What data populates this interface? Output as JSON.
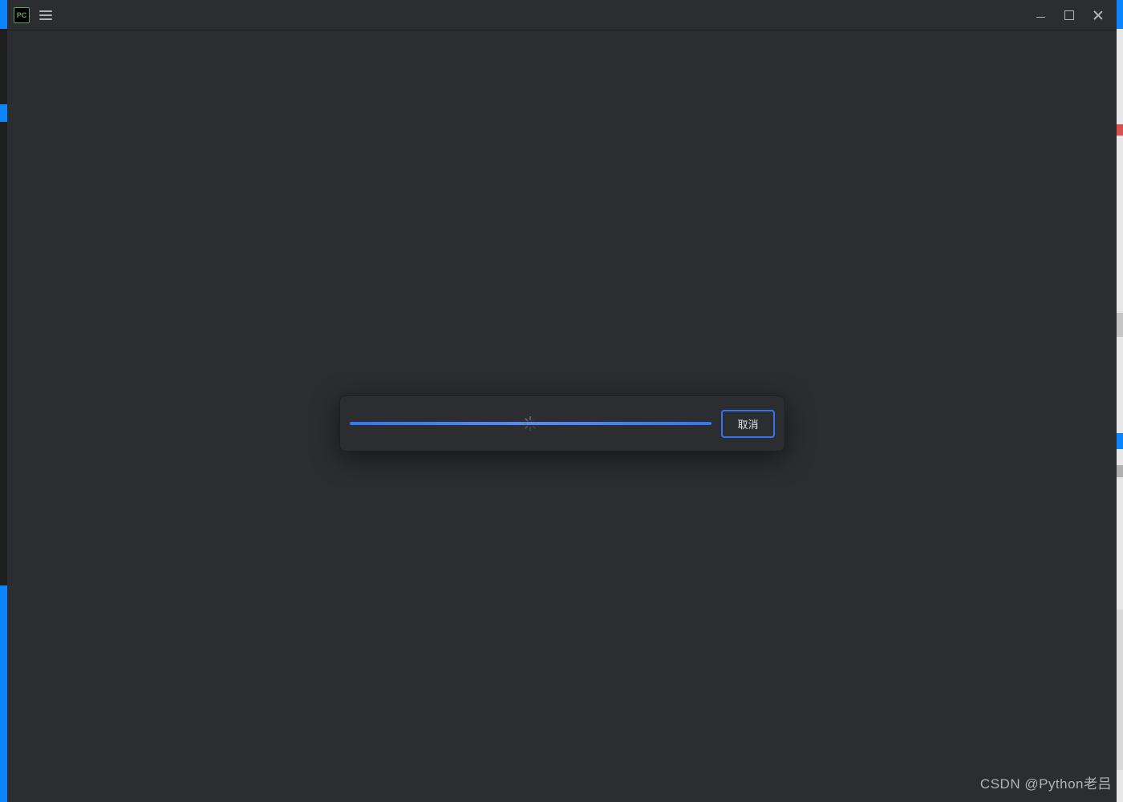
{
  "app": {
    "icon_label": "PC"
  },
  "dialog": {
    "cancel_label": "取消"
  },
  "watermark": {
    "text": "CSDN @Python老吕"
  },
  "colors": {
    "accent": "#3574f0",
    "background": "#2b2d30",
    "text": "#dfe1e5"
  }
}
